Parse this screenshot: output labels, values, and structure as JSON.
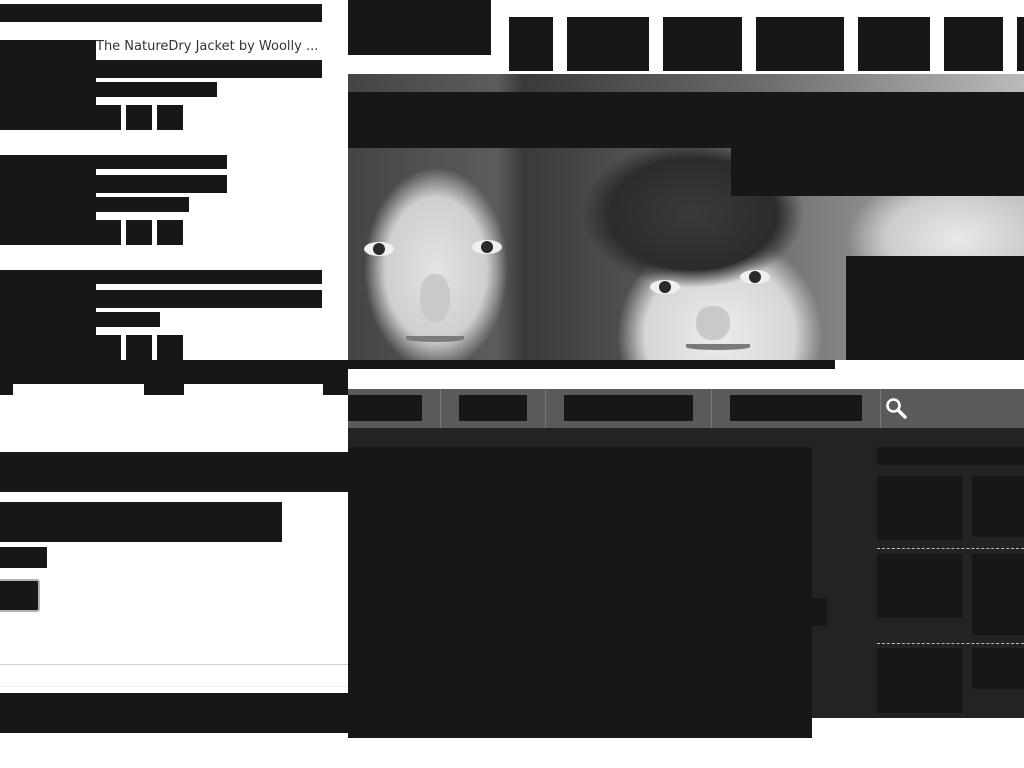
{
  "products": [
    {
      "title": "The NatureDry Jacket by Woolly ..."
    }
  ]
}
